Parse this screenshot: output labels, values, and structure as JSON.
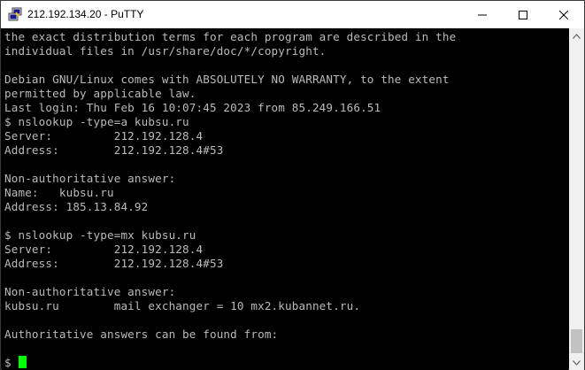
{
  "window": {
    "title": "212.192.134.20 - PuTTY",
    "icon": "putty-icon",
    "controls": {
      "minimize_icon": "minimize-icon",
      "maximize_icon": "maximize-icon",
      "close_icon": "close-icon"
    }
  },
  "terminal": {
    "text_color": "#bbbbbb",
    "background": "#000000",
    "cursor_color": "#00ff00",
    "lines": [
      "the exact distribution terms for each program are described in the",
      "individual files in /usr/share/doc/*/copyright.",
      "",
      "Debian GNU/Linux comes with ABSOLUTELY NO WARRANTY, to the extent",
      "permitted by applicable law.",
      "Last login: Thu Feb 16 10:07:45 2023 from 85.249.166.51",
      "$ nslookup -type=a kubsu.ru",
      "Server:         212.192.128.4",
      "Address:        212.192.128.4#53",
      "",
      "Non-authoritative answer:",
      "Name:   kubsu.ru",
      "Address: 185.13.84.92",
      "",
      "$ nslookup -type=mx kubsu.ru",
      "Server:         212.192.128.4",
      "Address:        212.192.128.4#53",
      "",
      "Non-authoritative answer:",
      "kubsu.ru        mail exchanger = 10 mx2.kubannet.ru.",
      "",
      "Authoritative answers can be found from:",
      ""
    ],
    "prompt": "$"
  },
  "scrollbar": {
    "up_icon": "scroll-up-arrow-icon",
    "down_icon": "scroll-down-arrow-icon"
  }
}
